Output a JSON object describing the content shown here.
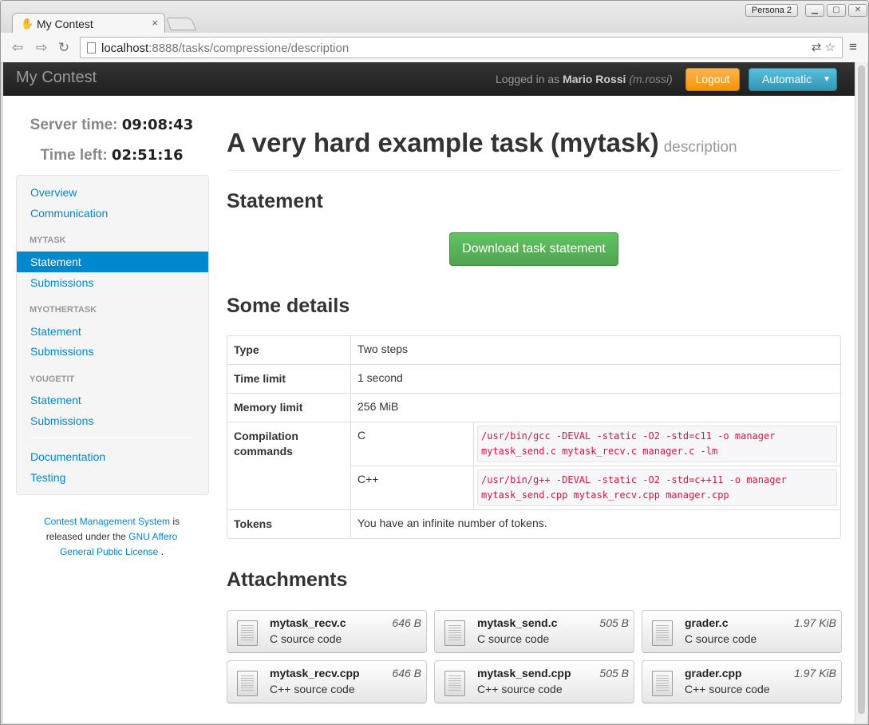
{
  "browser": {
    "tab_title": "My Contest",
    "tab_close": "×",
    "profile": "Persona 2",
    "url_host": "localhost",
    "url_rest": ":8888/tasks/compressione/description"
  },
  "navbar": {
    "brand": "My Contest",
    "logged_in_prefix": "Logged in as ",
    "user_name": "Mario Rossi",
    "username": "(m.rossi)",
    "logout": "Logout",
    "language_select": "Automatic"
  },
  "sidebar": {
    "server_time_label": "Server time:",
    "server_time": "09:08:43",
    "time_left_label": "Time left:",
    "time_left": "02:51:16",
    "overview": "Overview",
    "communication": "Communication",
    "tasks": [
      {
        "header": "MYTASK",
        "statement": "Statement",
        "submissions": "Submissions"
      },
      {
        "header": "MYOTHERTASK",
        "statement": "Statement",
        "submissions": "Submissions"
      },
      {
        "header": "YOUGETIT",
        "statement": "Statement",
        "submissions": "Submissions"
      }
    ],
    "documentation": "Documentation",
    "testing": "Testing"
  },
  "footer": {
    "cms_link": "Contest Management System",
    "released": " is released under the ",
    "license_link": "GNU Affero General Public License",
    "end": " ."
  },
  "main": {
    "task_title": "A very hard example task (mytask)",
    "task_subtitle": "description",
    "statement_heading": "Statement",
    "download_button": "Download task statement",
    "details_heading": "Some details",
    "details": {
      "type_label": "Type",
      "type_value": "Two steps",
      "time_label": "Time limit",
      "time_value": "1 second",
      "memory_label": "Memory limit",
      "memory_value": "256 MiB",
      "compilation_label": "Compilation commands",
      "c_lang": "C",
      "c_cmd": "/usr/bin/gcc -DEVAL -static -O2 -std=c11 -o manager mytask_send.c mytask_recv.c manager.c -lm",
      "cpp_lang": "C++",
      "cpp_cmd": "/usr/bin/g++ -DEVAL -static -O2 -std=c++11 -o manager mytask_send.cpp mytask_recv.cpp manager.cpp",
      "tokens_label": "Tokens",
      "tokens_value": "You have an infinite number of tokens."
    },
    "attachments_heading": "Attachments",
    "attachments": [
      {
        "name": "mytask_recv.c",
        "size": "646 B",
        "type": "C source code"
      },
      {
        "name": "mytask_send.c",
        "size": "505 B",
        "type": "C source code"
      },
      {
        "name": "grader.c",
        "size": "1.97 KiB",
        "type": "C source code"
      },
      {
        "name": "mytask_recv.cpp",
        "size": "646 B",
        "type": "C++ source code"
      },
      {
        "name": "mytask_send.cpp",
        "size": "505 B",
        "type": "C++ source code"
      },
      {
        "name": "grader.cpp",
        "size": "1.97 KiB",
        "type": "C++ source code"
      }
    ]
  }
}
